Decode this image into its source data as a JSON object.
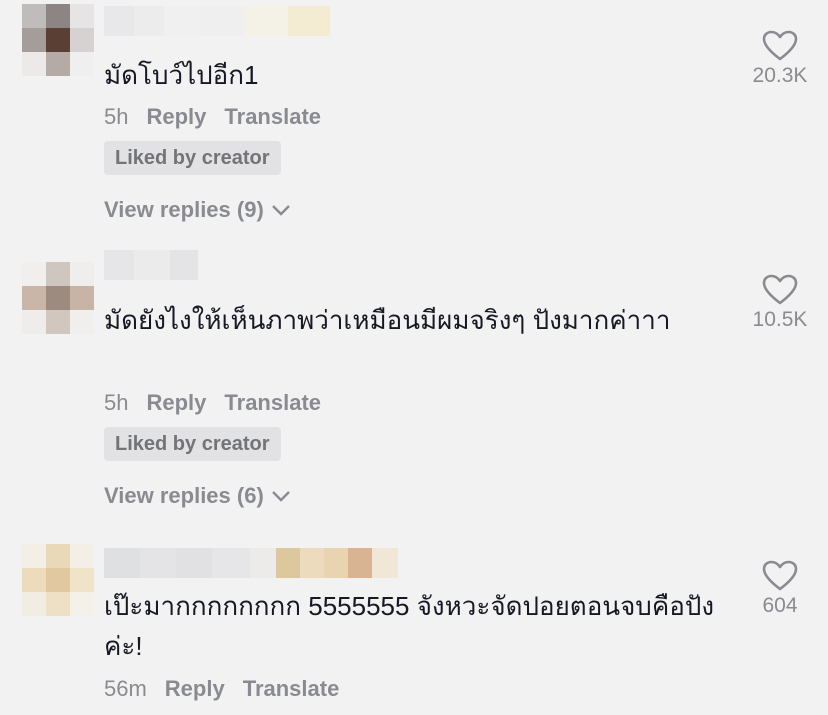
{
  "actions": {
    "reply": "Reply",
    "translate": "Translate",
    "liked_by_creator": "Liked by creator"
  },
  "comments": [
    {
      "text": "มัดโบว์ไปอีก1",
      "time": "5h",
      "likes": "20.3K",
      "view_replies": "View replies (9)"
    },
    {
      "text": "มัดยังไงให้เห็นภาพว่าเหมือนมีผมจริงๆ ปังมากค่าาา",
      "time": "5h",
      "likes": "10.5K",
      "view_replies": "View replies (6)"
    },
    {
      "text": "เป๊ะมากกกกกกกก 5555555 จังหวะจัดปอยตอนจบคือปังค่ะ!",
      "time": "56m",
      "likes": "604"
    }
  ],
  "icons": {
    "like": "heart-outline-icon",
    "expand": "chevron-down-icon"
  },
  "colors": {
    "background": "#f2f2f3",
    "secondary_text": "#8a8b91",
    "badge_bg": "#e2e2e4"
  }
}
